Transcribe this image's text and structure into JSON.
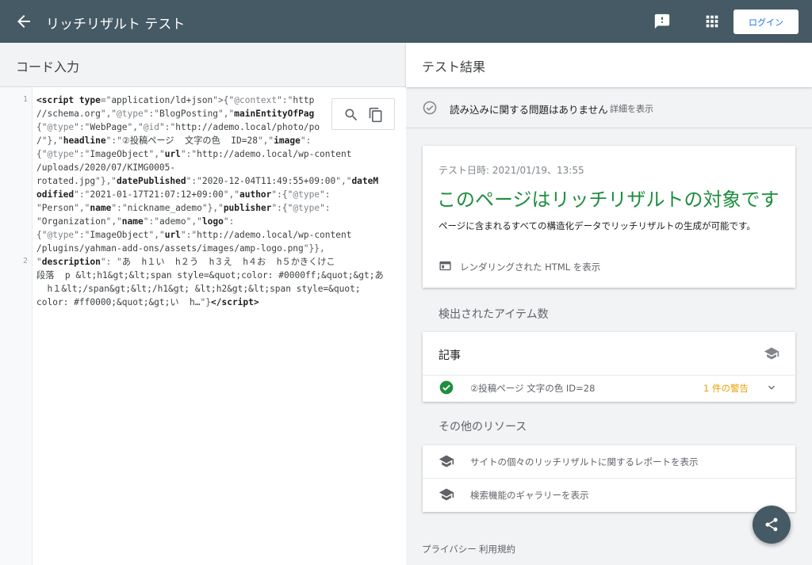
{
  "topbar": {
    "title": "リッチリザルト テスト",
    "login_label": "ログイン",
    "icons": [
      "back-arrow-icon",
      "feedback-icon",
      "apps-grid-icon"
    ]
  },
  "code_panel": {
    "title": "コード入力",
    "line_numbers": [
      "1",
      "2"
    ],
    "tools": [
      "search-icon",
      "copy-icon"
    ]
  },
  "results": {
    "title": "テスト結果",
    "status_text": "読み込みに関する問題はありません",
    "status_link": "詳細を表示",
    "test_date": "テスト日時: 2021/01/19、13:55",
    "headline": "このページはリッチリザルトの対象です",
    "subline": "ページに含まれるすべての構造化データでリッチリザルトの生成が可能です。",
    "rendered_html_link": "レンダリングされた HTML を表示",
    "detected_label": "検出されたアイテム数",
    "item_category": "記事",
    "item_name": "②投稿ページ 文字の色 ID=28",
    "item_warning": "1 件の警告",
    "other_label": "その他のリソース",
    "links": [
      "サイトの個々のリッチリザルトに関するレポートを表示",
      "検索機能のギャラリーを表示"
    ],
    "footer": [
      "プライバシー",
      "利用規約"
    ]
  },
  "colors": {
    "topbar": "#455a64",
    "success_green": "#1e8e3e",
    "warning_orange": "#e8a000",
    "link_blue": "#1a73e8"
  }
}
